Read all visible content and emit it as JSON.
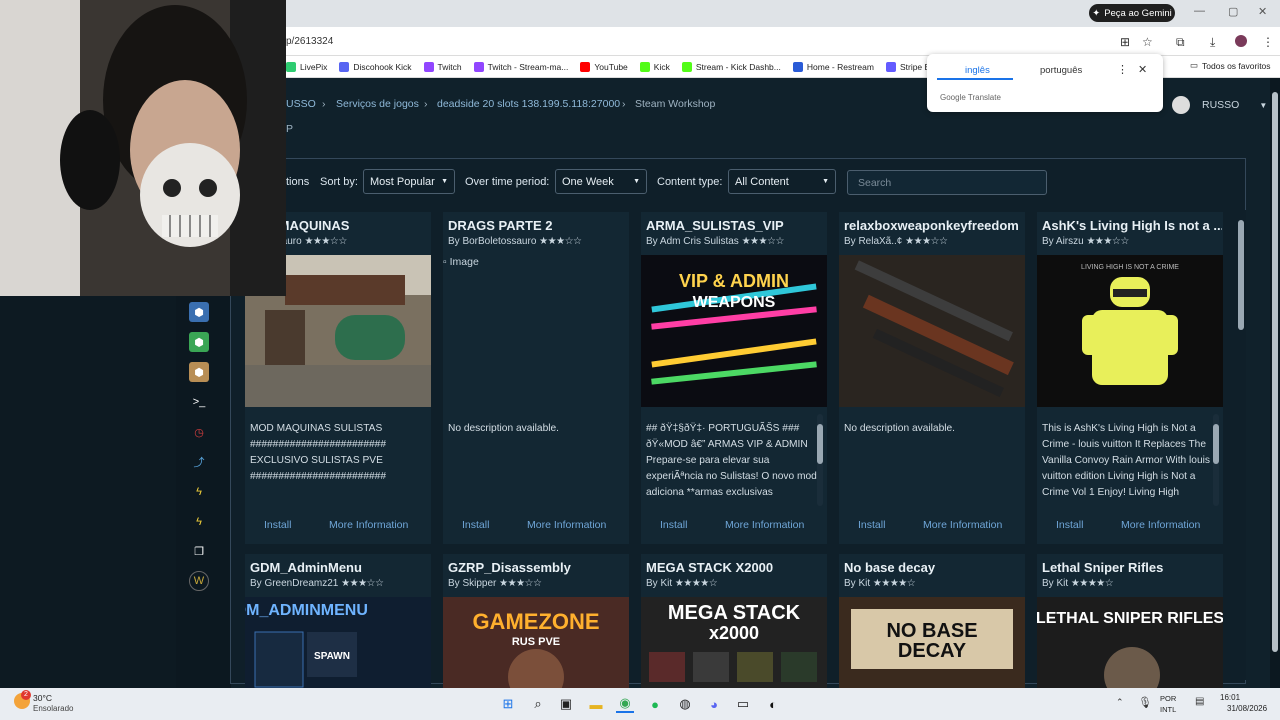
{
  "browser": {
    "url": "p/2613324",
    "gemini_button": "Peça ao Gemini",
    "bookmarks": [
      {
        "label": "LivePix",
        "color": "#2ecc71"
      },
      {
        "label": "Discohook Kick",
        "color": "#5865f2"
      },
      {
        "label": "Twitch",
        "color": "#9146ff"
      },
      {
        "label": "Twitch - Stream-ma...",
        "color": "#9146ff"
      },
      {
        "label": "YouTube",
        "color": "#ff0000"
      },
      {
        "label": "Kick",
        "color": "#53fc18"
      },
      {
        "label": "Stream - Kick Dashb...",
        "color": "#53fc18"
      },
      {
        "label": "Home - Restream",
        "color": "#2a5bd7"
      },
      {
        "label": "Stripe Express",
        "color": "#635bff"
      }
    ],
    "all_favorites": "Todos os favoritos"
  },
  "translate_popup": {
    "lang_selected": "inglês",
    "lang_other": "português",
    "brand": "Google",
    "brand_suffix": "Translate"
  },
  "breadcrumb": {
    "items": [
      "USSO",
      "Serviços de jogos",
      "deadside 20 slots 138.199.5.118:27000",
      "Steam Workshop"
    ],
    "subtitle": "P"
  },
  "user": {
    "name": "RUSSO"
  },
  "filters": {
    "options_label": "tions",
    "sort_label": "Sort by:",
    "sort_value": "Most Popular",
    "period_label": "Over time period:",
    "period_value": "One Week",
    "content_label": "Content type:",
    "content_value": "All Content",
    "search_placeholder": "Search"
  },
  "cards": [
    {
      "title": "TAS MAQUINAS",
      "by": "oletossauro",
      "stars": "★★★☆☆",
      "desc": "MOD MAQUINAS SULISTAS ######################## EXCLUSIVO SULISTAS PVE ########################",
      "install": "Install",
      "more": "More Information",
      "image": "sulistas"
    },
    {
      "title": "DRAGS PARTE 2",
      "by": "By BorBoletossauro",
      "stars": "★★★☆☆",
      "desc": "No description available.",
      "install": "Install",
      "more": "More Information",
      "image": "broken",
      "broken_alt": "Image"
    },
    {
      "title": "ARMA_SULISTAS_VIP",
      "by": "By Adm Cris Sulistas",
      "stars": "★★★☆☆",
      "desc": "## ðŸ‡§ðŸ‡· PORTUGUÃŠS ### ðŸ«MOD â€” ARMAS VIP & ADMIN Prepare-se para elevar sua experiÃªncia no Sulistas! O novo mod adiciona **armas exclusivas",
      "install": "Install",
      "more": "More Information",
      "image": "vip"
    },
    {
      "title": "relaxboxweaponkeyfreedom",
      "by": "By RelaXã..¢",
      "stars": "★★★☆☆",
      "desc": "No description available.",
      "install": "Install",
      "more": "More Information",
      "image": "rifle"
    },
    {
      "title": "AshK's Living High Is not a ...",
      "by": "By Airszu",
      "stars": "★★★☆☆",
      "desc": "This is AshK's Living High is Not a Crime - louis vuitton It Replaces The Vanilla Convoy Rain Armor With louis vuitton edition Living High is Not a Crime Vol 1 Enjoy! Living High",
      "install": "Install",
      "more": "More Information",
      "image": "armor",
      "image_text": "LIVING HIGH IS NOT A CRIME"
    },
    {
      "title": "GDM_AdminMenu",
      "by": "By GreenDreamz21",
      "stars": "★★★☆☆",
      "image": "gdm",
      "image_text": "GDM_ADMINMENU",
      "image_sub": "SPAWN"
    },
    {
      "title": "GZRP_Disassembly",
      "by": "By Skipper",
      "stars": "★★★☆☆",
      "image": "gamezone",
      "image_text": "GAMEZONE",
      "image_sub": "RUS PVE"
    },
    {
      "title": "MEGA STACK X2000",
      "by": "By Kit",
      "stars": "★★★★☆",
      "image": "mega",
      "image_text": "MEGA STACK",
      "image_sub": "x2000"
    },
    {
      "title": "No base decay",
      "by": "By Kit",
      "stars": "★★★★☆",
      "image": "nobase",
      "image_text": "NO BASE",
      "image_sub": "DECAY"
    },
    {
      "title": "Lethal Sniper Rifles",
      "by": "By Kit",
      "stars": "★★★★☆",
      "image": "lethal",
      "image_text": "LETHAL SNIPER RIFLES"
    }
  ],
  "taskbar": {
    "weather_temp": "30°C",
    "weather_desc": "Ensolarado",
    "weather_badge": "2",
    "lang_top": "POR",
    "lang_bottom": "INTL",
    "time": "16:01",
    "date": "31/08/2026"
  },
  "colors": {
    "accent_link": "#6fa6d8",
    "page_bg": "#10212b",
    "card_bg": "#132733"
  }
}
